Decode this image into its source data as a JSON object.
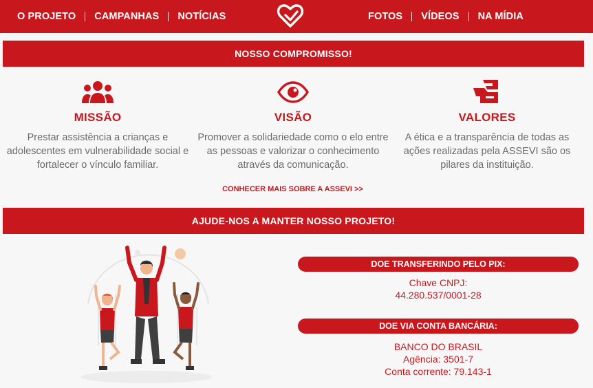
{
  "nav": {
    "left": [
      "O PROJETO",
      "CAMPANHAS",
      "NOTÍCIAS"
    ],
    "right": [
      "FOTOS",
      "VÍDEOS",
      "NA MÍDIA"
    ]
  },
  "commitment": {
    "heading": "NOSSO COMPROMISSO!",
    "columns": [
      {
        "icon": "people-icon",
        "title": "MISSÃO",
        "text": "Prestar assistência a crianças e adolescentes em vulnerabilidade social e fortalecer o vínculo familiar."
      },
      {
        "icon": "eye-icon",
        "title": "VISÃO",
        "text": "Promover a solidariedade como o elo entre as pessoas e valorizar o conhecimento através da comunicação."
      },
      {
        "icon": "handshake-icon",
        "title": "VALORES",
        "text": "A ética e a transparência de todas as ações realizadas pela ASSEVI são os pilares da instituição."
      }
    ],
    "more_link": "CONHECER MAIS SOBRE A ASSEVI >>"
  },
  "help": {
    "heading": "AJUDE-NOS A MANTER NOSSO PROJETO!",
    "pix_label": "DOE TRANSFERINDO PELO PIX:",
    "pix_lines": [
      "Chave CNPJ:",
      "44.280.537/0001-28"
    ],
    "bank_label": "DOE VIA CONTA BANCÁRIA:",
    "bank_lines": [
      "BANCO DO BRASIL",
      "Agência: 3501-7",
      "Conta corrente: 79.143-1"
    ]
  },
  "colors": {
    "brand_red": "#c8181e",
    "text_gray": "#6b6b6b",
    "background": "#f7f7f7"
  }
}
